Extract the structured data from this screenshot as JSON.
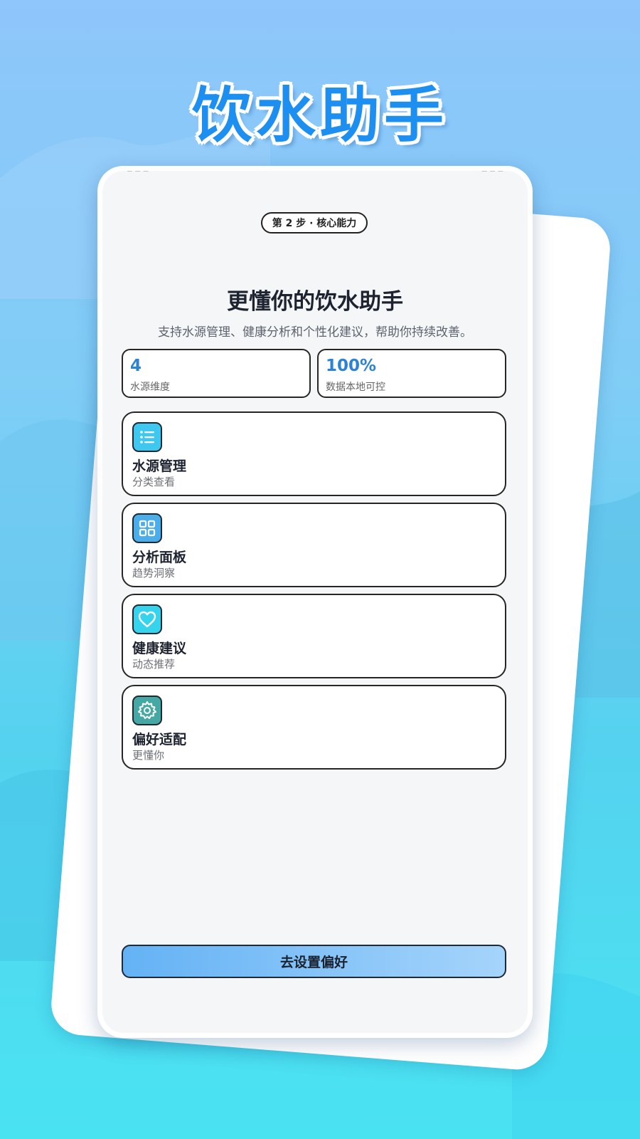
{
  "promo_title": "饮水助手",
  "step_pill": "第 2 步 · 核心能力",
  "headline": "更懂你的饮水助手",
  "subheadline": "支持水源管理、健康分析和个性化建议，帮助你持续改善。",
  "stats": [
    {
      "value": "4",
      "label": "水源维度"
    },
    {
      "value": "100%",
      "label": "数据本地可控"
    }
  ],
  "features": [
    {
      "title": "水源管理",
      "subtitle": "分类查看",
      "icon": "list-icon",
      "color": "#3fc8ef"
    },
    {
      "title": "分析面板",
      "subtitle": "趋势洞察",
      "icon": "grid-icon",
      "color": "#4baeea"
    },
    {
      "title": "健康建议",
      "subtitle": "动态推荐",
      "icon": "heart-icon",
      "color": "#36d3ec"
    },
    {
      "title": "偏好适配",
      "subtitle": "更懂你",
      "icon": "gear-icon",
      "color": "#46a8a4"
    }
  ],
  "cta_label": "去设置偏好",
  "colors": {
    "accent": "#2c83d6",
    "title_blue": "#1d8ff0",
    "cta_gradient_start": "#64b2f5",
    "cta_gradient_end": "#a5d4fb"
  }
}
